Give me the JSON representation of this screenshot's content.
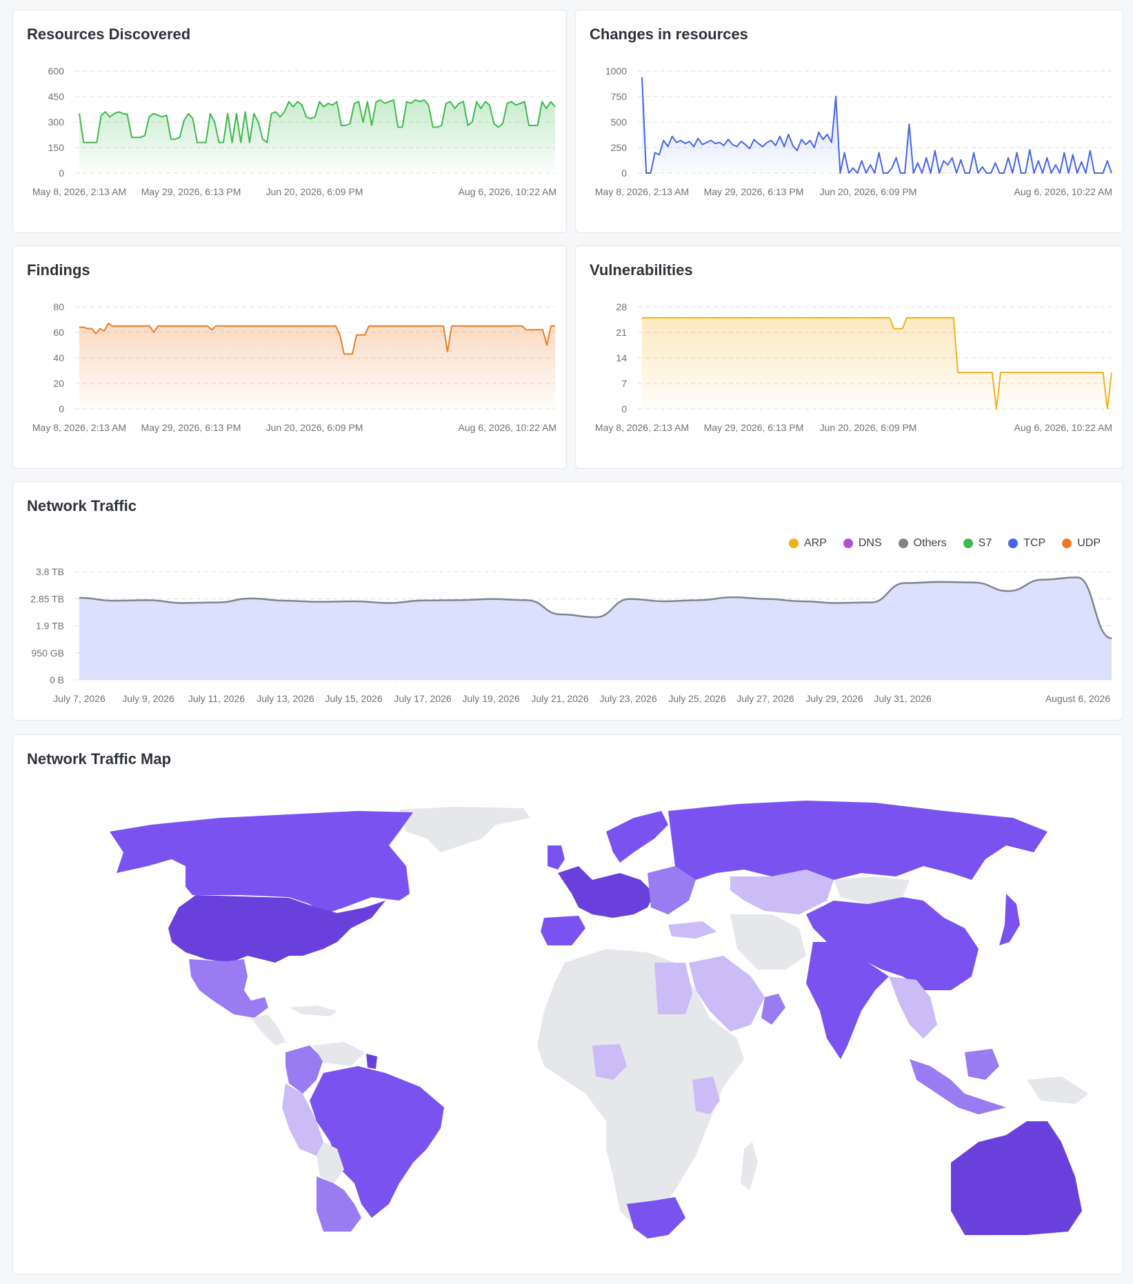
{
  "colors": {
    "green": "#3cb94d",
    "blue": "#4564e6",
    "orange": "#f07a22",
    "yellow": "#f2b01c",
    "gray": "#7f838c",
    "mapLight": "#e5e7eb",
    "mapLav": "#cbbcf7",
    "mapMed": "#9a7bf2",
    "mapPurple": "#7a52f0",
    "mapDark": "#6a40dd"
  },
  "chart_data": [
    {
      "type": "area",
      "title": "Resources Discovered",
      "ylim": [
        0,
        600
      ],
      "yticks": [
        "0",
        "150",
        "300",
        "450",
        "600"
      ],
      "xticks": [
        "May 8, 2026, 2:13 AM",
        "May 29, 2026, 6:13 PM",
        "Jun 20, 2026, 6:09 PM",
        "Aug 6, 2026, 10:22 AM"
      ],
      "color": "#3cb94d",
      "values": [
        350,
        180,
        180,
        180,
        180,
        340,
        360,
        330,
        350,
        360,
        350,
        345,
        210,
        210,
        210,
        220,
        330,
        350,
        340,
        330,
        340,
        200,
        200,
        210,
        310,
        350,
        320,
        180,
        180,
        180,
        350,
        300,
        180,
        180,
        350,
        180,
        350,
        180,
        360,
        180,
        350,
        300,
        200,
        180,
        350,
        360,
        330,
        360,
        420,
        390,
        420,
        400,
        330,
        320,
        330,
        420,
        390,
        410,
        400,
        420,
        280,
        280,
        290,
        410,
        420,
        300,
        420,
        280,
        420,
        430,
        410,
        420,
        430,
        270,
        270,
        420,
        410,
        430,
        420,
        430,
        400,
        270,
        270,
        280,
        410,
        420,
        380,
        410,
        420,
        280,
        300,
        420,
        380,
        420,
        400,
        290,
        270,
        290,
        410,
        420,
        400,
        410,
        420,
        280,
        280,
        280,
        420,
        380,
        420,
        390
      ]
    },
    {
      "type": "line",
      "title": "Changes in resources",
      "ylim": [
        0,
        1000
      ],
      "yticks": [
        "0",
        "250",
        "500",
        "750",
        "1000"
      ],
      "xticks": [
        "May 8, 2026, 2:13 AM",
        "May 29, 2026, 6:13 PM",
        "Jun 20, 2026, 6:09 PM",
        "Aug 6, 2026, 10:22 AM"
      ],
      "color": "#4564e6",
      "values": [
        940,
        0,
        0,
        200,
        180,
        320,
        260,
        360,
        300,
        320,
        290,
        310,
        260,
        340,
        280,
        300,
        320,
        290,
        300,
        270,
        330,
        280,
        260,
        310,
        280,
        240,
        330,
        290,
        260,
        300,
        320,
        270,
        360,
        260,
        380,
        270,
        220,
        330,
        280,
        320,
        250,
        400,
        330,
        380,
        300,
        750,
        0,
        200,
        0,
        50,
        0,
        120,
        0,
        80,
        0,
        200,
        0,
        0,
        50,
        150,
        0,
        0,
        480,
        0,
        100,
        0,
        150,
        0,
        220,
        0,
        120,
        80,
        150,
        0,
        130,
        0,
        0,
        200,
        0,
        60,
        0,
        0,
        100,
        0,
        0,
        150,
        0,
        200,
        0,
        0,
        230,
        0,
        120,
        0,
        150,
        0,
        80,
        0,
        200,
        0,
        180,
        0,
        110,
        0,
        220,
        0,
        0,
        0,
        120,
        0
      ]
    },
    {
      "type": "area",
      "title": "Findings",
      "ylim": [
        0,
        80
      ],
      "yticks": [
        "0",
        "20",
        "40",
        "60",
        "80"
      ],
      "xticks": [
        "May 8, 2026, 2:13 AM",
        "May 29, 2026, 6:13 PM",
        "Jun 20, 2026, 6:09 PM",
        "Aug 6, 2026, 10:22 AM"
      ],
      "color": "#f07a22",
      "values": [
        64,
        64,
        63,
        63,
        59,
        63,
        61,
        67,
        65,
        65,
        65,
        65,
        65,
        65,
        65,
        65,
        65,
        65,
        60,
        65,
        65,
        65,
        65,
        65,
        65,
        65,
        65,
        65,
        65,
        65,
        65,
        65,
        62,
        65,
        65,
        65,
        65,
        65,
        65,
        65,
        65,
        65,
        65,
        65,
        65,
        65,
        65,
        65,
        65,
        65,
        65,
        65,
        65,
        65,
        65,
        65,
        65,
        65,
        65,
        65,
        65,
        65,
        65,
        58,
        43,
        43,
        43,
        58,
        58,
        58,
        65,
        65,
        65,
        65,
        65,
        65,
        65,
        65,
        65,
        65,
        65,
        65,
        65,
        65,
        65,
        65,
        65,
        65,
        65,
        45,
        65,
        65,
        65,
        65,
        65,
        65,
        65,
        65,
        65,
        65,
        65,
        65,
        65,
        65,
        65,
        65,
        65,
        65,
        62,
        62,
        62,
        62,
        62,
        50,
        65,
        65
      ]
    },
    {
      "type": "area",
      "title": "Vulnerabilities",
      "ylim": [
        0,
        28
      ],
      "yticks": [
        "0",
        "7",
        "14",
        "21",
        "28"
      ],
      "xticks": [
        "May 8, 2026, 2:13 AM",
        "May 29, 2026, 6:13 PM",
        "Jun 20, 2026, 6:09 PM",
        "Aug 6, 2026, 10:22 AM"
      ],
      "color": "#f2b01c",
      "values": [
        25,
        25,
        25,
        25,
        25,
        25,
        25,
        25,
        25,
        25,
        25,
        25,
        25,
        25,
        25,
        25,
        25,
        25,
        25,
        25,
        25,
        25,
        25,
        25,
        25,
        25,
        25,
        25,
        25,
        25,
        25,
        25,
        25,
        25,
        25,
        25,
        25,
        25,
        25,
        25,
        25,
        25,
        25,
        25,
        25,
        25,
        25,
        25,
        25,
        25,
        25,
        25,
        25,
        25,
        25,
        25,
        25,
        25,
        25,
        22,
        22,
        22,
        25,
        25,
        25,
        25,
        25,
        25,
        25,
        25,
        25,
        25,
        25,
        25,
        10,
        10,
        10,
        10,
        10,
        10,
        10,
        10,
        10,
        0,
        10,
        10,
        10,
        10,
        10,
        10,
        10,
        10,
        10,
        10,
        10,
        10,
        10,
        10,
        10,
        10,
        10,
        10,
        10,
        10,
        10,
        10,
        10,
        10,
        10,
        0,
        10
      ]
    },
    {
      "type": "area",
      "title": "Network Traffic",
      "ylim": [
        0,
        3.8
      ],
      "yticks": [
        "0 B",
        "950 GB",
        "1.9 TB",
        "2.85 TB",
        "3.8 TB"
      ],
      "xticks": [
        "July 7, 2026",
        "July 9, 2026",
        "July 11, 2026",
        "July 13, 2026",
        "July 15, 2026",
        "July 17, 2026",
        "July 19, 2026",
        "July 21, 2026",
        "July 23, 2026",
        "July 25, 2026",
        "July 27, 2026",
        "July 29, 2026",
        "July 31, 2026",
        "August 6, 2026"
      ],
      "legend": [
        {
          "name": "ARP",
          "color": "#f2b01c"
        },
        {
          "name": "DNS",
          "color": "#b44fd8"
        },
        {
          "name": "Others",
          "color": "#7f838c"
        },
        {
          "name": "S7",
          "color": "#3cb94d"
        },
        {
          "name": "TCP",
          "color": "#4564e6"
        },
        {
          "name": "UDP",
          "color": "#f07a22"
        }
      ],
      "values": [
        2.88,
        2.78,
        2.8,
        2.7,
        2.72,
        2.86,
        2.78,
        2.74,
        2.76,
        2.7,
        2.79,
        2.8,
        2.84,
        2.8,
        2.3,
        2.2,
        2.84,
        2.76,
        2.8,
        2.9,
        2.84,
        2.76,
        2.7,
        2.72,
        3.4,
        3.44,
        3.42,
        3.12,
        3.52,
        3.6,
        1.46
      ]
    }
  ],
  "map": {
    "title": "Network Traffic Map"
  }
}
